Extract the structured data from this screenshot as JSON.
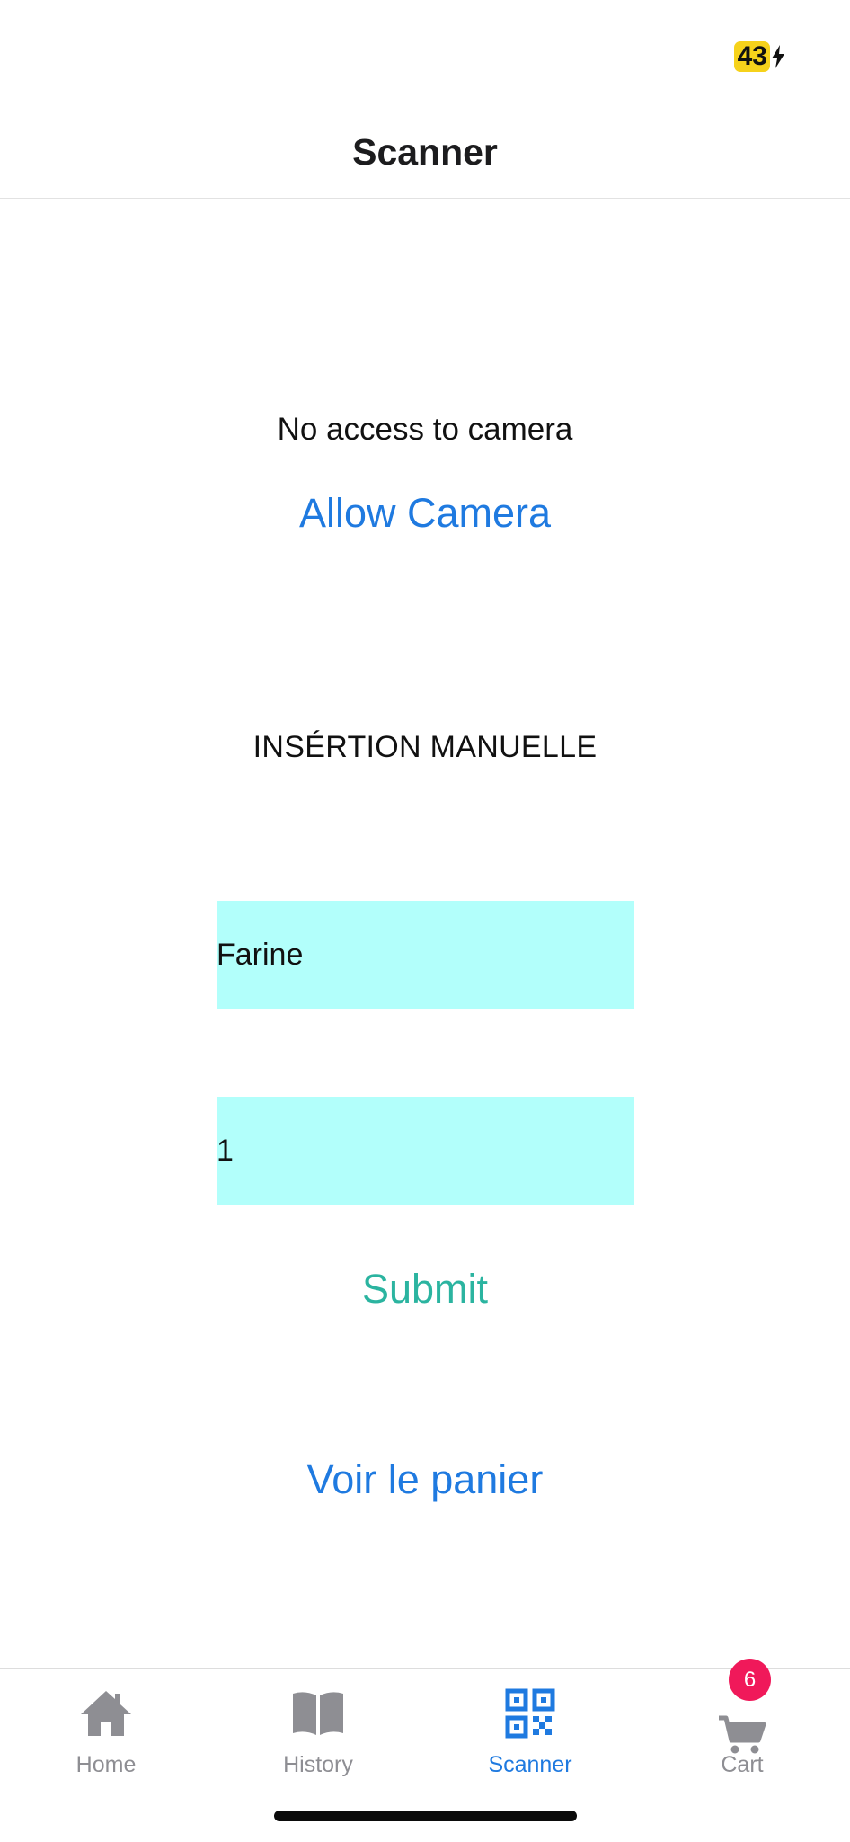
{
  "status_bar": {
    "battery_level": "43"
  },
  "header": {
    "title": "Scanner"
  },
  "camera": {
    "message": "No access to camera",
    "allow_label": "Allow Camera"
  },
  "manual": {
    "title": "INSÉRTION MANUELLE",
    "product_value": "Farine",
    "quantity_value": "1",
    "submit_label": "Submit",
    "input_color": "#b2fffb"
  },
  "cart_link": {
    "label": "Voir le panier"
  },
  "tab_bar": {
    "items": [
      {
        "label": "Home",
        "icon": "home-icon"
      },
      {
        "label": "History",
        "icon": "book-icon"
      },
      {
        "label": "Scanner",
        "icon": "qr-code-icon",
        "active": true
      },
      {
        "label": "Cart",
        "icon": "cart-icon"
      }
    ],
    "cart_badge": "6",
    "active_color": "#1f7ae0",
    "inactive_color": "#8e8e93"
  }
}
